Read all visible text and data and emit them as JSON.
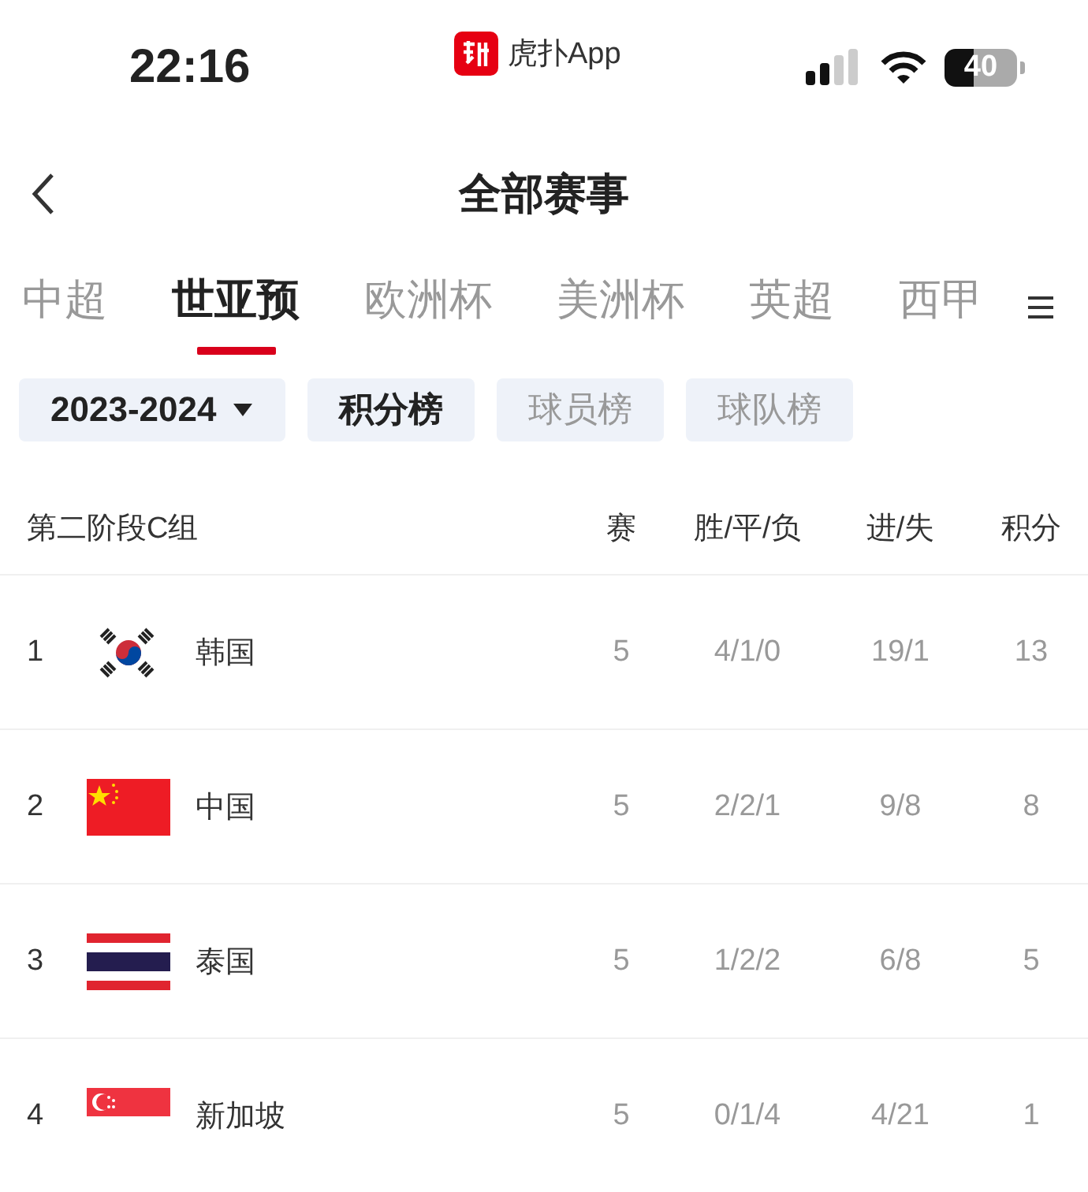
{
  "status_bar": {
    "time": "22:16",
    "app_name": "虎扑App",
    "battery": "40"
  },
  "header": {
    "title": "全部赛事"
  },
  "tabs": [
    {
      "label": "中超",
      "selected": false
    },
    {
      "label": "世亚预",
      "selected": true
    },
    {
      "label": "欧洲杯",
      "selected": false
    },
    {
      "label": "美洲杯",
      "selected": false
    },
    {
      "label": "英超",
      "selected": false
    },
    {
      "label": "西甲",
      "selected": false
    }
  ],
  "season": "2023-2024",
  "filters": [
    {
      "label": "积分榜",
      "selected": true
    },
    {
      "label": "球员榜",
      "selected": false
    },
    {
      "label": "球队榜",
      "selected": false
    }
  ],
  "table": {
    "group": "第二阶段C组",
    "columns": [
      "赛",
      "胜/平/负",
      "进/失",
      "积分"
    ],
    "rows": [
      {
        "rank": "1",
        "kind": "kr",
        "team": "韩国",
        "played": "5",
        "wdl": "4/1/0",
        "goals": "19/1",
        "points": "13"
      },
      {
        "rank": "2",
        "kind": "cn",
        "team": "中国",
        "played": "5",
        "wdl": "2/2/1",
        "goals": "9/8",
        "points": "8"
      },
      {
        "rank": "3",
        "kind": "th",
        "team": "泰国",
        "played": "5",
        "wdl": "1/2/2",
        "goals": "6/8",
        "points": "5"
      },
      {
        "rank": "4",
        "kind": "sg",
        "team": "新加坡",
        "played": "5",
        "wdl": "0/1/4",
        "goals": "4/21",
        "points": "1"
      }
    ]
  }
}
